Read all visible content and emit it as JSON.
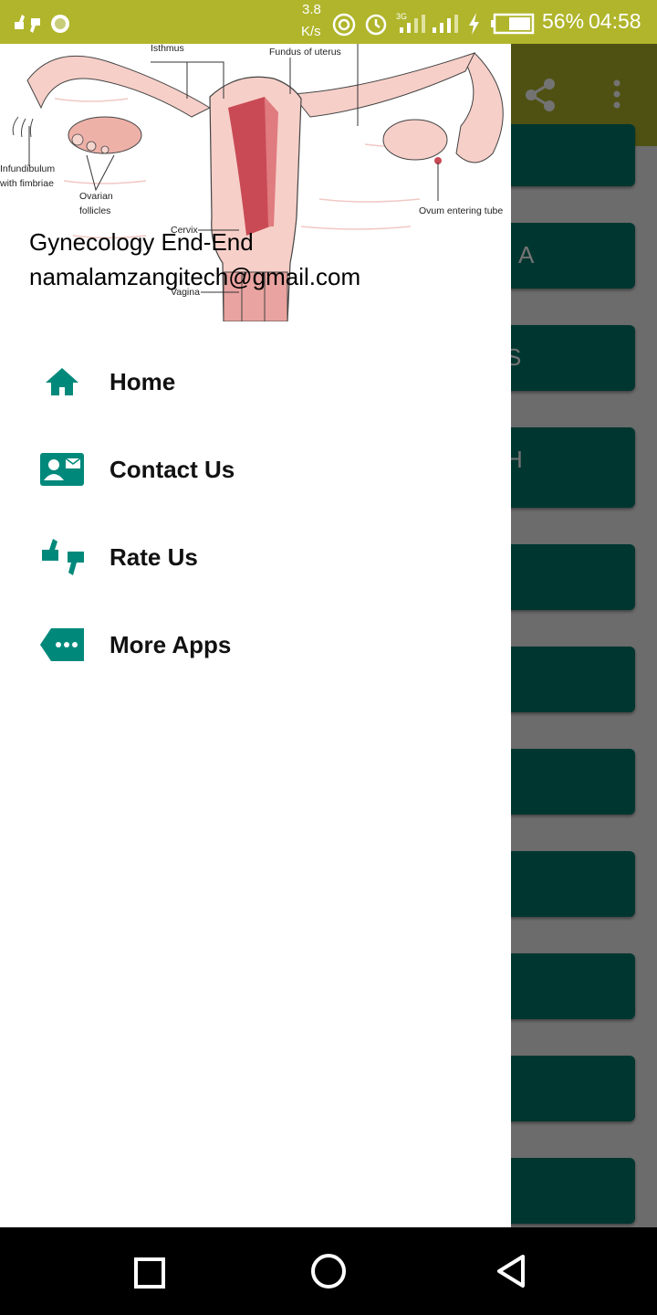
{
  "status_bar": {
    "net_speed_value": "3.8",
    "net_speed_unit": "K/s",
    "battery": "56%",
    "time": "04:58",
    "icons": [
      "rate-icon",
      "record-icon",
      "hotspot-icon",
      "alarm-icon",
      "signal-3g-icon",
      "signal-icon",
      "charging-icon",
      "battery-icon"
    ]
  },
  "app_bar": {
    "icons": [
      "share-icon",
      "more-vert-icon"
    ]
  },
  "background_buttons": [
    "",
    "A",
    "S",
    "H",
    "",
    "",
    "",
    "",
    "",
    "",
    ""
  ],
  "drawer": {
    "header": {
      "title": "Gynecology End-End",
      "email": "namalamzangitech@gmail.com",
      "diagram_labels": {
        "isthmus": "Isthmus",
        "fundus": "Fundus of uterus",
        "infundibulum_1": "Infundibulum",
        "infundibulum_2": "with fimbriae",
        "ovarian_1": "Ovarian",
        "ovarian_2": "follicles",
        "ovum": "Ovum entering tube",
        "cervix": "Cervix",
        "vagina": "Vagina"
      }
    },
    "items": [
      {
        "label": "Home",
        "icon": "home-icon"
      },
      {
        "label": "Contact Us",
        "icon": "contact-card-icon"
      },
      {
        "label": "Rate Us",
        "icon": "thumbs-icon"
      },
      {
        "label": "More Apps",
        "icon": "more-apps-icon"
      }
    ]
  },
  "colors": {
    "status": "#b0b52b",
    "accent": "#00897b",
    "button": "#00796b"
  }
}
